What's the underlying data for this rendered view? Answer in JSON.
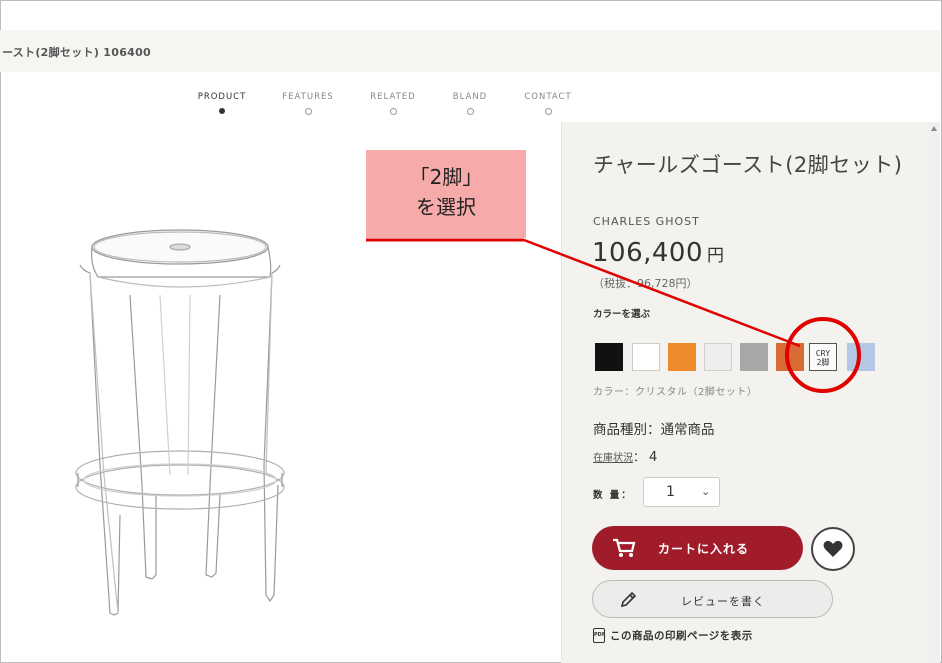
{
  "breadcrumb": "ースト(2脚セット) 106400",
  "tabs": [
    {
      "label": "PRODUCT",
      "active": true
    },
    {
      "label": "FEATURES",
      "active": false
    },
    {
      "label": "RELATED",
      "active": false
    },
    {
      "label": "BLAND",
      "active": false
    },
    {
      "label": "CONTACT",
      "active": false
    }
  ],
  "product": {
    "title": "チャールズゴースト(2脚セット)",
    "brand": "CHARLES GHOST",
    "price": "106,400",
    "price_unit": "円",
    "price_excl_tax": "（税抜：96,728円）",
    "color_label": "カラーを選ぶ",
    "swatches": [
      {
        "name": "black",
        "color": "#111111"
      },
      {
        "name": "white",
        "color": "#ffffff"
      },
      {
        "name": "orange",
        "color": "#ef8a2d"
      },
      {
        "name": "light-gray",
        "color": "#eeeeee"
      },
      {
        "name": "gray",
        "color": "#a7a7a7"
      },
      {
        "name": "dark-orange",
        "color": "#d86b33"
      },
      {
        "name": "crystal-2set",
        "color": "#fafafa",
        "label_line1": "CRY",
        "label_line2": "2脚",
        "selected": true
      },
      {
        "name": "light-blue",
        "color": "#b3c8e6"
      }
    ],
    "color_name": "カラー：クリスタル（2脚セット）",
    "product_type": "商品種別：通常商品",
    "stock_label": "在庫状況",
    "stock_sep": "：",
    "stock_value": "4",
    "quantity_label": "数 量：",
    "quantity_value": "1",
    "cart_button": "カートに入れる",
    "review_button": "レビューを書く",
    "print_icon": "PDF",
    "print_link": "この商品の印刷ページを表示"
  },
  "annotation": {
    "callout_line1": "「2脚」",
    "callout_line2": "を選択",
    "callout_color": "#f6aaaa",
    "highlight_color": "#e00000"
  }
}
